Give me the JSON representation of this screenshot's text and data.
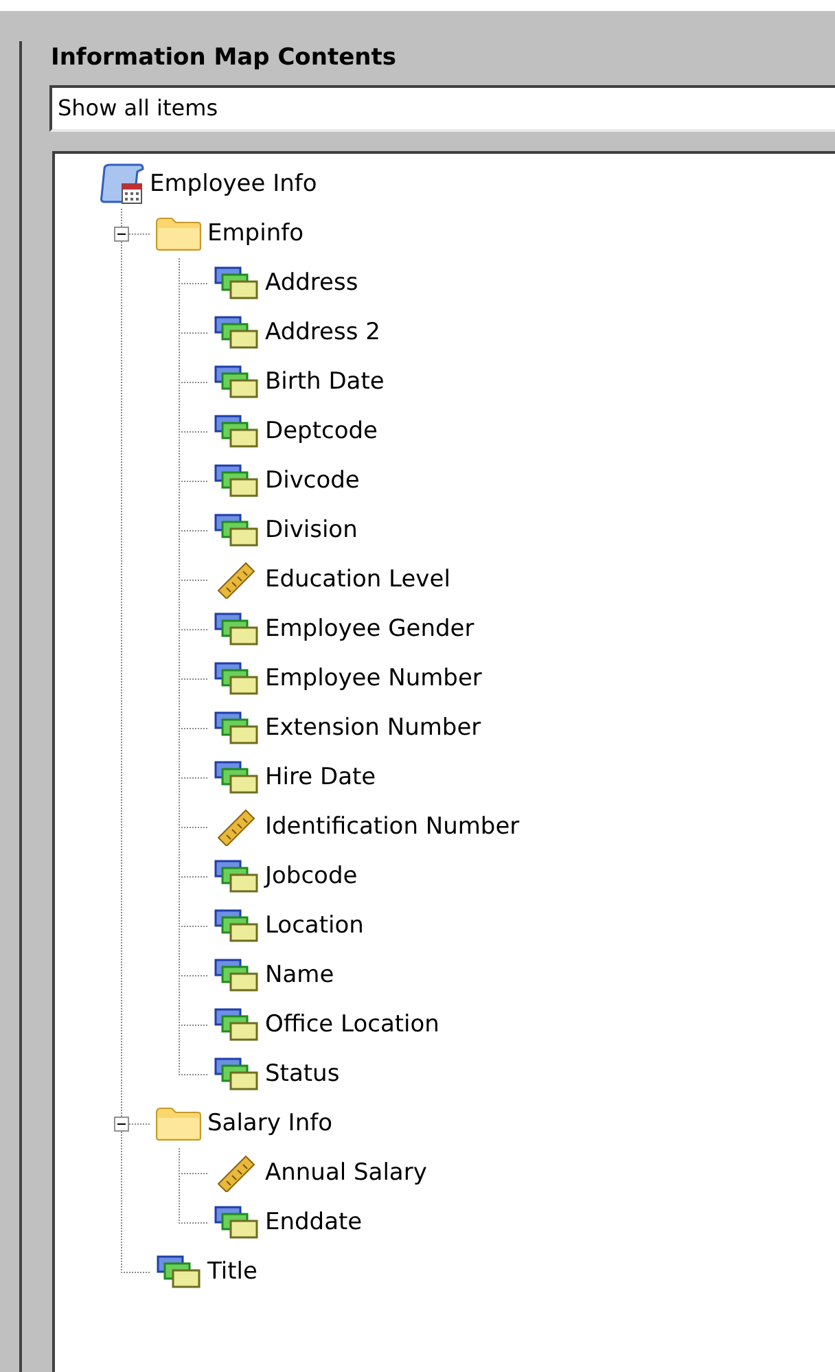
{
  "panel": {
    "title": "Information Map Contents"
  },
  "filter": {
    "value": "Show all items"
  },
  "tree": [
    {
      "label": "Employee Info",
      "kind": "root",
      "children": [
        {
          "label": "Empinfo",
          "kind": "folder",
          "expanded": true,
          "children": [
            {
              "label": "Address",
              "kind": "data"
            },
            {
              "label": "Address 2",
              "kind": "data"
            },
            {
              "label": "Birth Date",
              "kind": "data"
            },
            {
              "label": "Deptcode",
              "kind": "data"
            },
            {
              "label": "Divcode",
              "kind": "data"
            },
            {
              "label": "Division",
              "kind": "data"
            },
            {
              "label": "Education Level",
              "kind": "measure"
            },
            {
              "label": "Employee Gender",
              "kind": "data"
            },
            {
              "label": "Employee Number",
              "kind": "data"
            },
            {
              "label": "Extension Number",
              "kind": "data"
            },
            {
              "label": "Hire Date",
              "kind": "data"
            },
            {
              "label": "Identification Number",
              "kind": "measure"
            },
            {
              "label": "Jobcode",
              "kind": "data"
            },
            {
              "label": "Location",
              "kind": "data"
            },
            {
              "label": "Name",
              "kind": "data"
            },
            {
              "label": "Office Location",
              "kind": "data"
            },
            {
              "label": "Status",
              "kind": "data"
            }
          ]
        },
        {
          "label": "Salary Info",
          "kind": "folder",
          "expanded": true,
          "children": [
            {
              "label": "Annual Salary",
              "kind": "measure"
            },
            {
              "label": "Enddate",
              "kind": "data"
            }
          ]
        },
        {
          "label": "Title",
          "kind": "data"
        }
      ]
    }
  ]
}
